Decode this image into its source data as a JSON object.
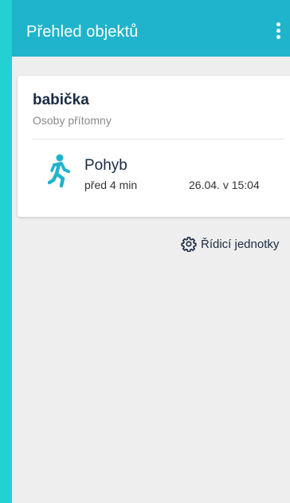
{
  "appbar": {
    "title": "Přehled objektů",
    "menu_icon": "more-vertical-icon"
  },
  "object_card": {
    "name": "babička",
    "status": "Osoby přítomny",
    "last_event": {
      "icon": "walking-person-icon",
      "label": "Pohyb",
      "ago": "před 4 min",
      "datetime": "26.04. v 15:04"
    }
  },
  "footer_link": {
    "icon": "gear-icon",
    "label": "Řídicí jednotky"
  },
  "colors": {
    "frame": "#23d0d2",
    "appbar": "#1fb4cb",
    "background": "#eeeeee",
    "accent_icon": "#1fb4cb",
    "dark_text": "#1a2b44"
  }
}
